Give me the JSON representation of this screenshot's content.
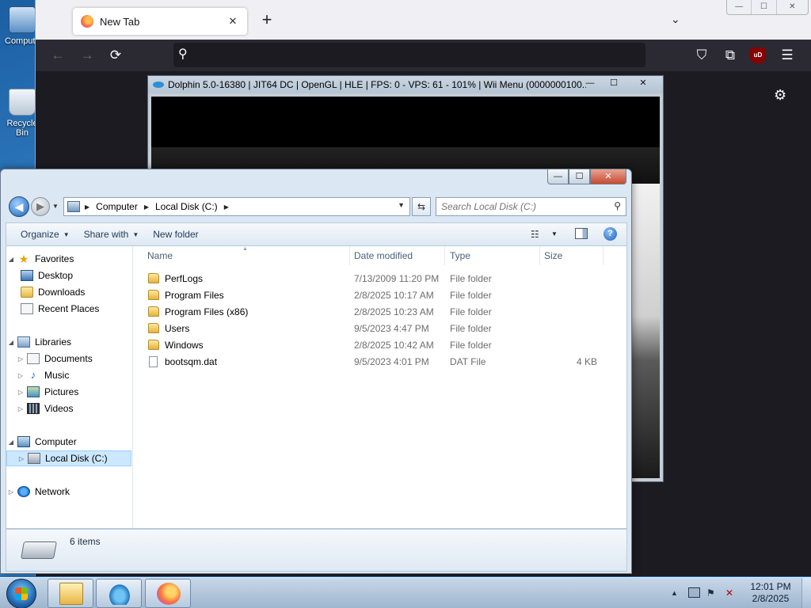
{
  "desktop": {
    "icons": [
      {
        "label": "Computer",
        "icon": "computer-icon"
      },
      {
        "label": "Recycle Bin",
        "icon": "recycle-bin-icon"
      }
    ]
  },
  "firefox": {
    "tab_title": "New Tab",
    "tab_close": "✕",
    "new_tab": "+",
    "tab_list": "⌄",
    "window_controls": {
      "minimize": "—",
      "maximize": "☐",
      "close": "✕"
    },
    "nav": {
      "back": "←",
      "forward": "→",
      "reload": "⟳"
    },
    "url_search_icon": "⚲",
    "url_value": "",
    "toolbar": {
      "pocket": "⛉",
      "extensions": "⧉",
      "ublock": "uD",
      "menu": "☰"
    },
    "settings_icon": "⚙"
  },
  "dolphin": {
    "title": "Dolphin 5.0-16380 | JIT64 DC | OpenGL | HLE | FPS: 0 - VPS: 61 - 101% | Wii Menu (0000000100...",
    "controls": {
      "minimize": "—",
      "maximize": "☐",
      "close": "✕"
    }
  },
  "explorer": {
    "window_controls": {
      "minimize": "—",
      "maximize": "☐",
      "close": "✕"
    },
    "nav": {
      "back": "◀",
      "forward": "▶",
      "recent": "▼"
    },
    "breadcrumb": [
      "Computer",
      "Local Disk (C:)"
    ],
    "breadcrumb_sep": "▶",
    "address_dropdown": "▼",
    "refresh": "⇆",
    "search_placeholder": "Search Local Disk (C:)",
    "search_icon": "⚲",
    "toolbar": {
      "organize": "Organize",
      "share_with": "Share with",
      "new_folder": "New folder",
      "caret": "▼",
      "views": "☷",
      "help": "?"
    },
    "nav_pane": {
      "favorites": "Favorites",
      "desktop": "Desktop",
      "downloads": "Downloads",
      "recent_places": "Recent Places",
      "libraries": "Libraries",
      "documents": "Documents",
      "music": "Music",
      "pictures": "Pictures",
      "videos": "Videos",
      "computer": "Computer",
      "local_disk": "Local Disk (C:)",
      "network": "Network",
      "expanded": "◢",
      "collapsed": "▷",
      "star": "★",
      "note": "♪"
    },
    "columns": {
      "name": "Name",
      "date_modified": "Date modified",
      "type": "Type",
      "size": "Size",
      "sort_arrow": "▲"
    },
    "files": [
      {
        "name": "PerfLogs",
        "date": "7/13/2009 11:20 PM",
        "type": "File folder",
        "size": "",
        "kind": "folder"
      },
      {
        "name": "Program Files",
        "date": "2/8/2025 10:17 AM",
        "type": "File folder",
        "size": "",
        "kind": "folder"
      },
      {
        "name": "Program Files (x86)",
        "date": "2/8/2025 10:23 AM",
        "type": "File folder",
        "size": "",
        "kind": "folder"
      },
      {
        "name": "Users",
        "date": "9/5/2023 4:47 PM",
        "type": "File folder",
        "size": "",
        "kind": "folder"
      },
      {
        "name": "Windows",
        "date": "2/8/2025 10:42 AM",
        "type": "File folder",
        "size": "",
        "kind": "folder"
      },
      {
        "name": "bootsqm.dat",
        "date": "9/5/2023 4:01 PM",
        "type": "DAT File",
        "size": "4 KB",
        "kind": "file"
      }
    ],
    "status": "6 items"
  },
  "taskbar": {
    "apps": [
      "Windows Explorer",
      "Dolphin",
      "Firefox"
    ],
    "tray": {
      "show_hidden": "▲",
      "action_center": "⚑",
      "volume": "✕"
    },
    "clock_time": "12:01 PM",
    "clock_date": "2/8/2025"
  }
}
